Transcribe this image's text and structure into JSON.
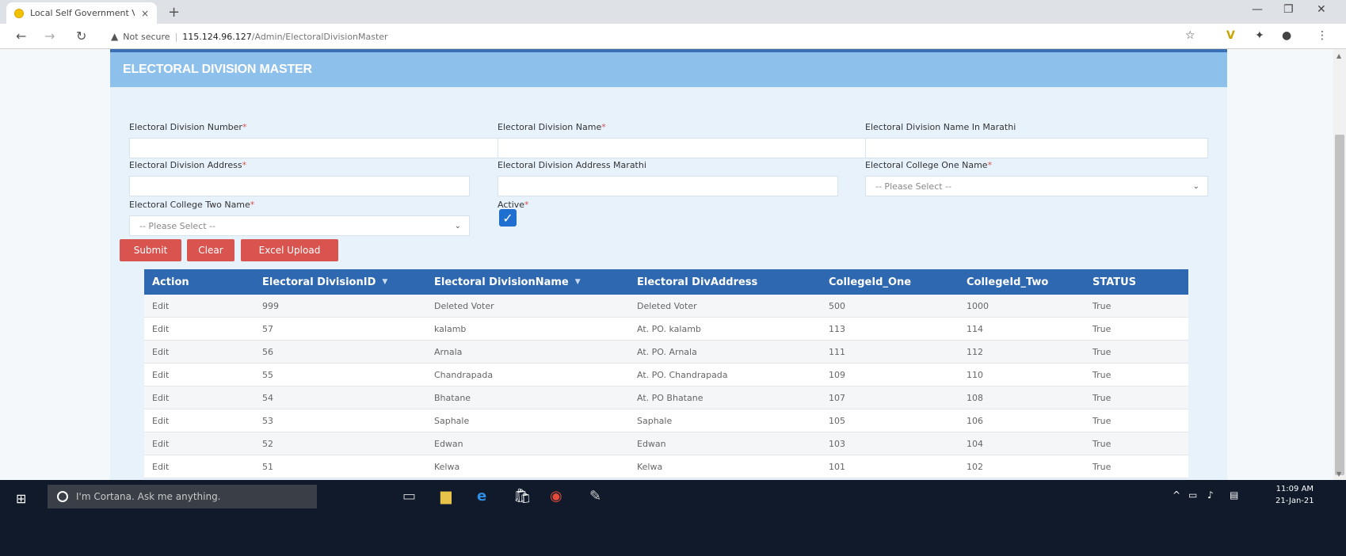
{
  "browser": {
    "tab_title": "Local Self Government Voterlist",
    "tab_close": "×",
    "new_tab": "+",
    "security_label": "Not secure",
    "url_host": "115.124.96.127",
    "url_path": "/Admin/ElectoralDivisionMaster"
  },
  "page": {
    "title": "ELECTORAL DIVISION MASTER"
  },
  "form": {
    "division_number_label": "Electoral Division Number",
    "division_name_label": "Electoral Division Name",
    "division_name_marathi_label": "Electoral Division Name In Marathi",
    "division_address_label": "Electoral Division Address",
    "division_address_marathi_label": "Electoral Division Address Marathi",
    "college_one_label": "Electoral College One Name",
    "college_one_value": "-- Please Select --",
    "college_two_label": "Electoral College Two Name",
    "college_two_value": "-- Please Select --",
    "active_label": "Active",
    "required_marker": "*"
  },
  "buttons": {
    "submit": "Submit",
    "clear": "Clear",
    "excel_upload": "Excel Upload"
  },
  "grid": {
    "columns": [
      "Action",
      "Electoral DivisionID",
      "Electoral DivisionName",
      "Electoral DivAddress",
      "CollegeId_One",
      "CollegeId_Two",
      "STATUS"
    ],
    "rows": [
      [
        "Edit",
        "999",
        "Deleted Voter",
        "Deleted Voter",
        "500",
        "1000",
        "True"
      ],
      [
        "Edit",
        "57",
        "kalamb",
        "At. PO. kalamb",
        "113",
        "114",
        "True"
      ],
      [
        "Edit",
        "56",
        "Arnala",
        "At. PO. Arnala",
        "111",
        "112",
        "True"
      ],
      [
        "Edit",
        "55",
        "Chandrapada",
        "At. PO. Chandrapada",
        "109",
        "110",
        "True"
      ],
      [
        "Edit",
        "54",
        "Bhatane",
        "At. PO Bhatane",
        "107",
        "108",
        "True"
      ],
      [
        "Edit",
        "53",
        "Saphale",
        "Saphale",
        "105",
        "106",
        "True"
      ],
      [
        "Edit",
        "52",
        "Edwan",
        "Edwan",
        "103",
        "104",
        "True"
      ],
      [
        "Edit",
        "51",
        "Kelwa",
        "Kelwa",
        "101",
        "102",
        "True"
      ]
    ]
  },
  "taskbar": {
    "cortana_placeholder": "I'm Cortana. Ask me anything.",
    "time": "11:09 AM",
    "date": "21-Jan-21"
  },
  "colors": {
    "panel_header": "#8ec0ec",
    "grid_header": "#2e68b0",
    "button_red": "#d9534f",
    "taskbar": "#101a2a"
  }
}
